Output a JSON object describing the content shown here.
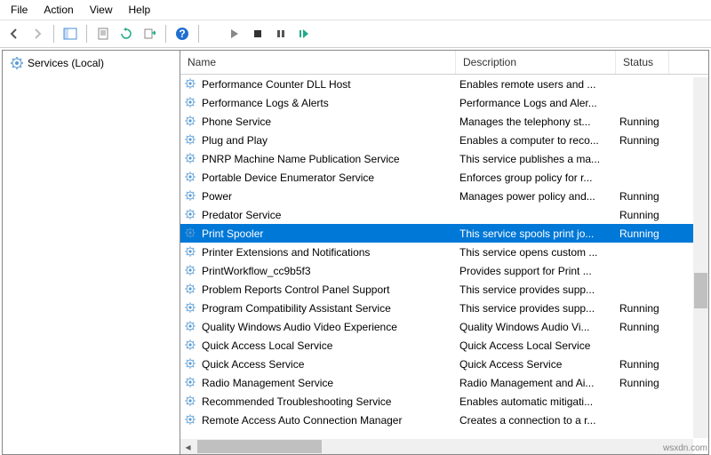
{
  "menu": {
    "file": "File",
    "action": "Action",
    "view": "View",
    "help": "Help"
  },
  "tree": {
    "root": "Services (Local)"
  },
  "columns": {
    "name": "Name",
    "description": "Description",
    "status": "Status"
  },
  "services": [
    {
      "name": "Performance Counter DLL Host",
      "desc": "Enables remote users and ...",
      "status": ""
    },
    {
      "name": "Performance Logs & Alerts",
      "desc": "Performance Logs and Aler...",
      "status": ""
    },
    {
      "name": "Phone Service",
      "desc": "Manages the telephony st...",
      "status": "Running"
    },
    {
      "name": "Plug and Play",
      "desc": "Enables a computer to reco...",
      "status": "Running"
    },
    {
      "name": "PNRP Machine Name Publication Service",
      "desc": "This service publishes a ma...",
      "status": ""
    },
    {
      "name": "Portable Device Enumerator Service",
      "desc": "Enforces group policy for r...",
      "status": ""
    },
    {
      "name": "Power",
      "desc": "Manages power policy and...",
      "status": "Running"
    },
    {
      "name": "Predator Service",
      "desc": "",
      "status": "Running"
    },
    {
      "name": "Print Spooler",
      "desc": "This service spools print jo...",
      "status": "Running",
      "selected": true
    },
    {
      "name": "Printer Extensions and Notifications",
      "desc": "This service opens custom ...",
      "status": ""
    },
    {
      "name": "PrintWorkflow_cc9b5f3",
      "desc": "Provides support for Print ...",
      "status": ""
    },
    {
      "name": "Problem Reports Control Panel Support",
      "desc": "This service provides supp...",
      "status": ""
    },
    {
      "name": "Program Compatibility Assistant Service",
      "desc": "This service provides supp...",
      "status": "Running"
    },
    {
      "name": "Quality Windows Audio Video Experience",
      "desc": "Quality Windows Audio Vi...",
      "status": "Running"
    },
    {
      "name": "Quick Access Local Service",
      "desc": "Quick Access Local Service",
      "status": ""
    },
    {
      "name": "Quick Access Service",
      "desc": "Quick Access Service",
      "status": "Running"
    },
    {
      "name": "Radio Management Service",
      "desc": "Radio Management and Ai...",
      "status": "Running"
    },
    {
      "name": "Recommended Troubleshooting Service",
      "desc": "Enables automatic mitigati...",
      "status": ""
    },
    {
      "name": "Remote Access Auto Connection Manager",
      "desc": "Creates a connection to a r...",
      "status": ""
    }
  ],
  "watermark": "wsxdn.com"
}
